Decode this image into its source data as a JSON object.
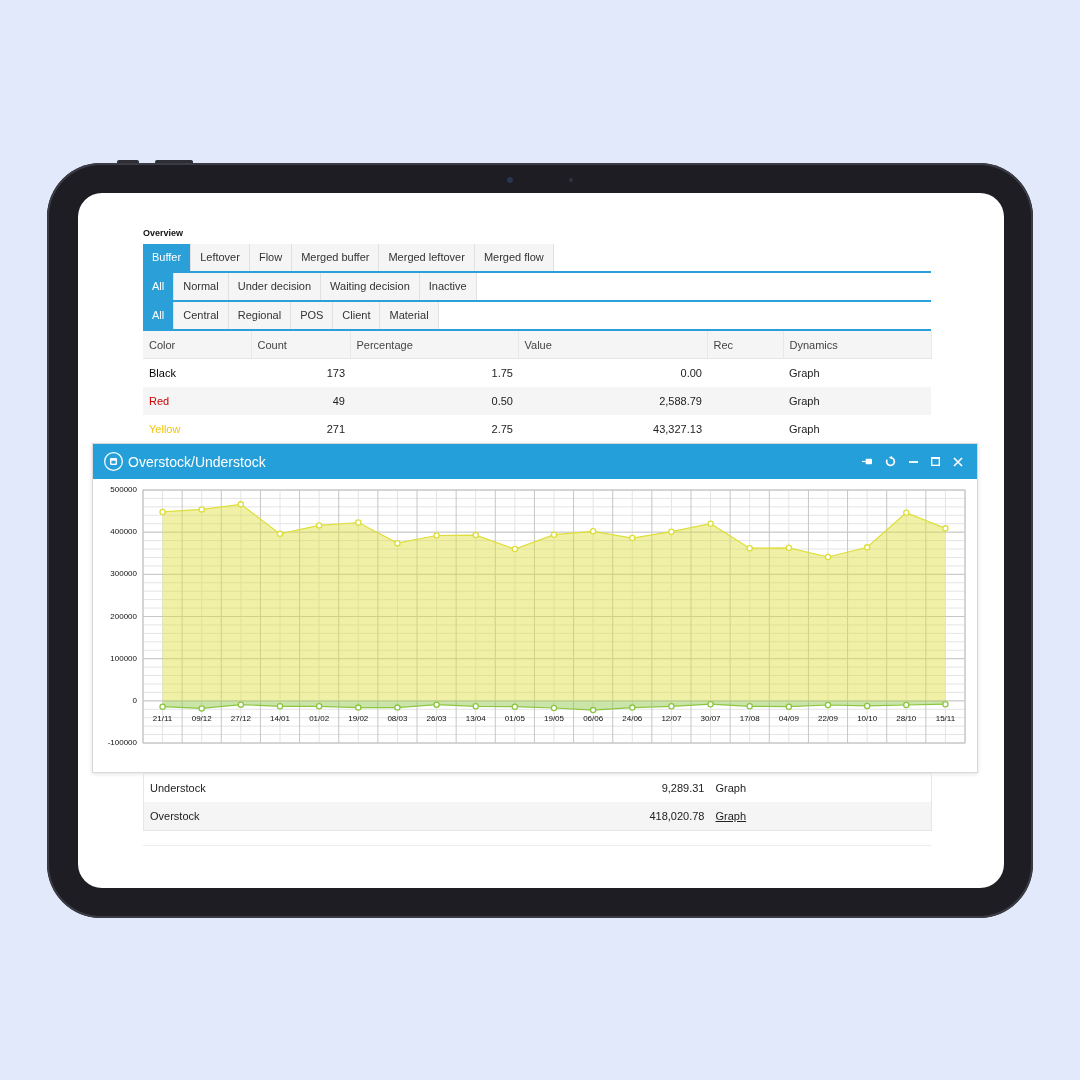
{
  "page": {
    "title": "Overview"
  },
  "tab_rows": [
    {
      "tabs": [
        {
          "label": "Buffer",
          "selected": true
        },
        {
          "label": "Leftover",
          "selected": false
        },
        {
          "label": "Flow",
          "selected": false
        },
        {
          "label": "Merged buffer",
          "selected": false
        },
        {
          "label": "Merged leftover",
          "selected": false
        },
        {
          "label": "Merged flow",
          "selected": false
        }
      ]
    },
    {
      "tabs": [
        {
          "label": "All",
          "selected": true
        },
        {
          "label": "Normal",
          "selected": false
        },
        {
          "label": "Under decision",
          "selected": false
        },
        {
          "label": "Waiting decision",
          "selected": false
        },
        {
          "label": "Inactive",
          "selected": false
        }
      ]
    },
    {
      "tabs": [
        {
          "label": "All",
          "selected": true
        },
        {
          "label": "Central",
          "selected": false
        },
        {
          "label": "Regional",
          "selected": false
        },
        {
          "label": "POS",
          "selected": false
        },
        {
          "label": "Client",
          "selected": false
        },
        {
          "label": "Material",
          "selected": false
        }
      ]
    }
  ],
  "table": {
    "columns": [
      "Color",
      "Count",
      "Percentage",
      "Value",
      "Rec",
      "Dynamics"
    ],
    "rows": [
      {
        "color_label": "Black",
        "color": "#000000",
        "count": "173",
        "percentage": "1.75",
        "value": "0.00",
        "dynamics": "Graph"
      },
      {
        "color_label": "Red",
        "color": "#cc0000",
        "count": "49",
        "percentage": "0.50",
        "value": "2,588.79",
        "dynamics": "Graph"
      },
      {
        "color_label": "Yellow",
        "color": "#f2c40f",
        "count": "271",
        "percentage": "2.75",
        "value": "43,327.13",
        "dynamics": "Graph"
      }
    ]
  },
  "dialog": {
    "title": "Overstock/Understock",
    "chart_data": {
      "type": "area",
      "categories": [
        "21/11",
        "09/12",
        "27/12",
        "14/01",
        "01/02",
        "19/02",
        "08/03",
        "26/03",
        "13/04",
        "01/05",
        "19/05",
        "06/06",
        "24/06",
        "12/07",
        "30/07",
        "17/08",
        "04/09",
        "22/09",
        "10/10",
        "28/10",
        "15/11"
      ],
      "series": [
        {
          "color": "#dede3a",
          "values": [
            448000,
            454000,
            466000,
            396000,
            416000,
            423000,
            374000,
            392000,
            393000,
            360000,
            394000,
            402000,
            386000,
            401000,
            420000,
            362000,
            363000,
            341000,
            364000,
            446000,
            409000
          ]
        },
        {
          "color": "#8cc63f",
          "values": [
            -14000,
            -18000,
            -9000,
            -13000,
            -13000,
            -16000,
            -16000,
            -9000,
            -13000,
            -14000,
            -17000,
            -22000,
            -16000,
            -13000,
            -8000,
            -13000,
            -14000,
            -10000,
            -12000,
            -10000,
            -8000
          ]
        }
      ],
      "ylim": [
        -100000,
        500000
      ],
      "yticks": [
        -100000,
        0,
        100000,
        200000,
        300000,
        400000,
        500000
      ],
      "grid": true
    }
  },
  "summary": {
    "rows": [
      {
        "label": "Understock",
        "value": "9,289.31",
        "link": "Graph",
        "hovered": false
      },
      {
        "label": "Overstock",
        "value": "418,020.78",
        "link": "Graph",
        "hovered": true
      }
    ]
  }
}
